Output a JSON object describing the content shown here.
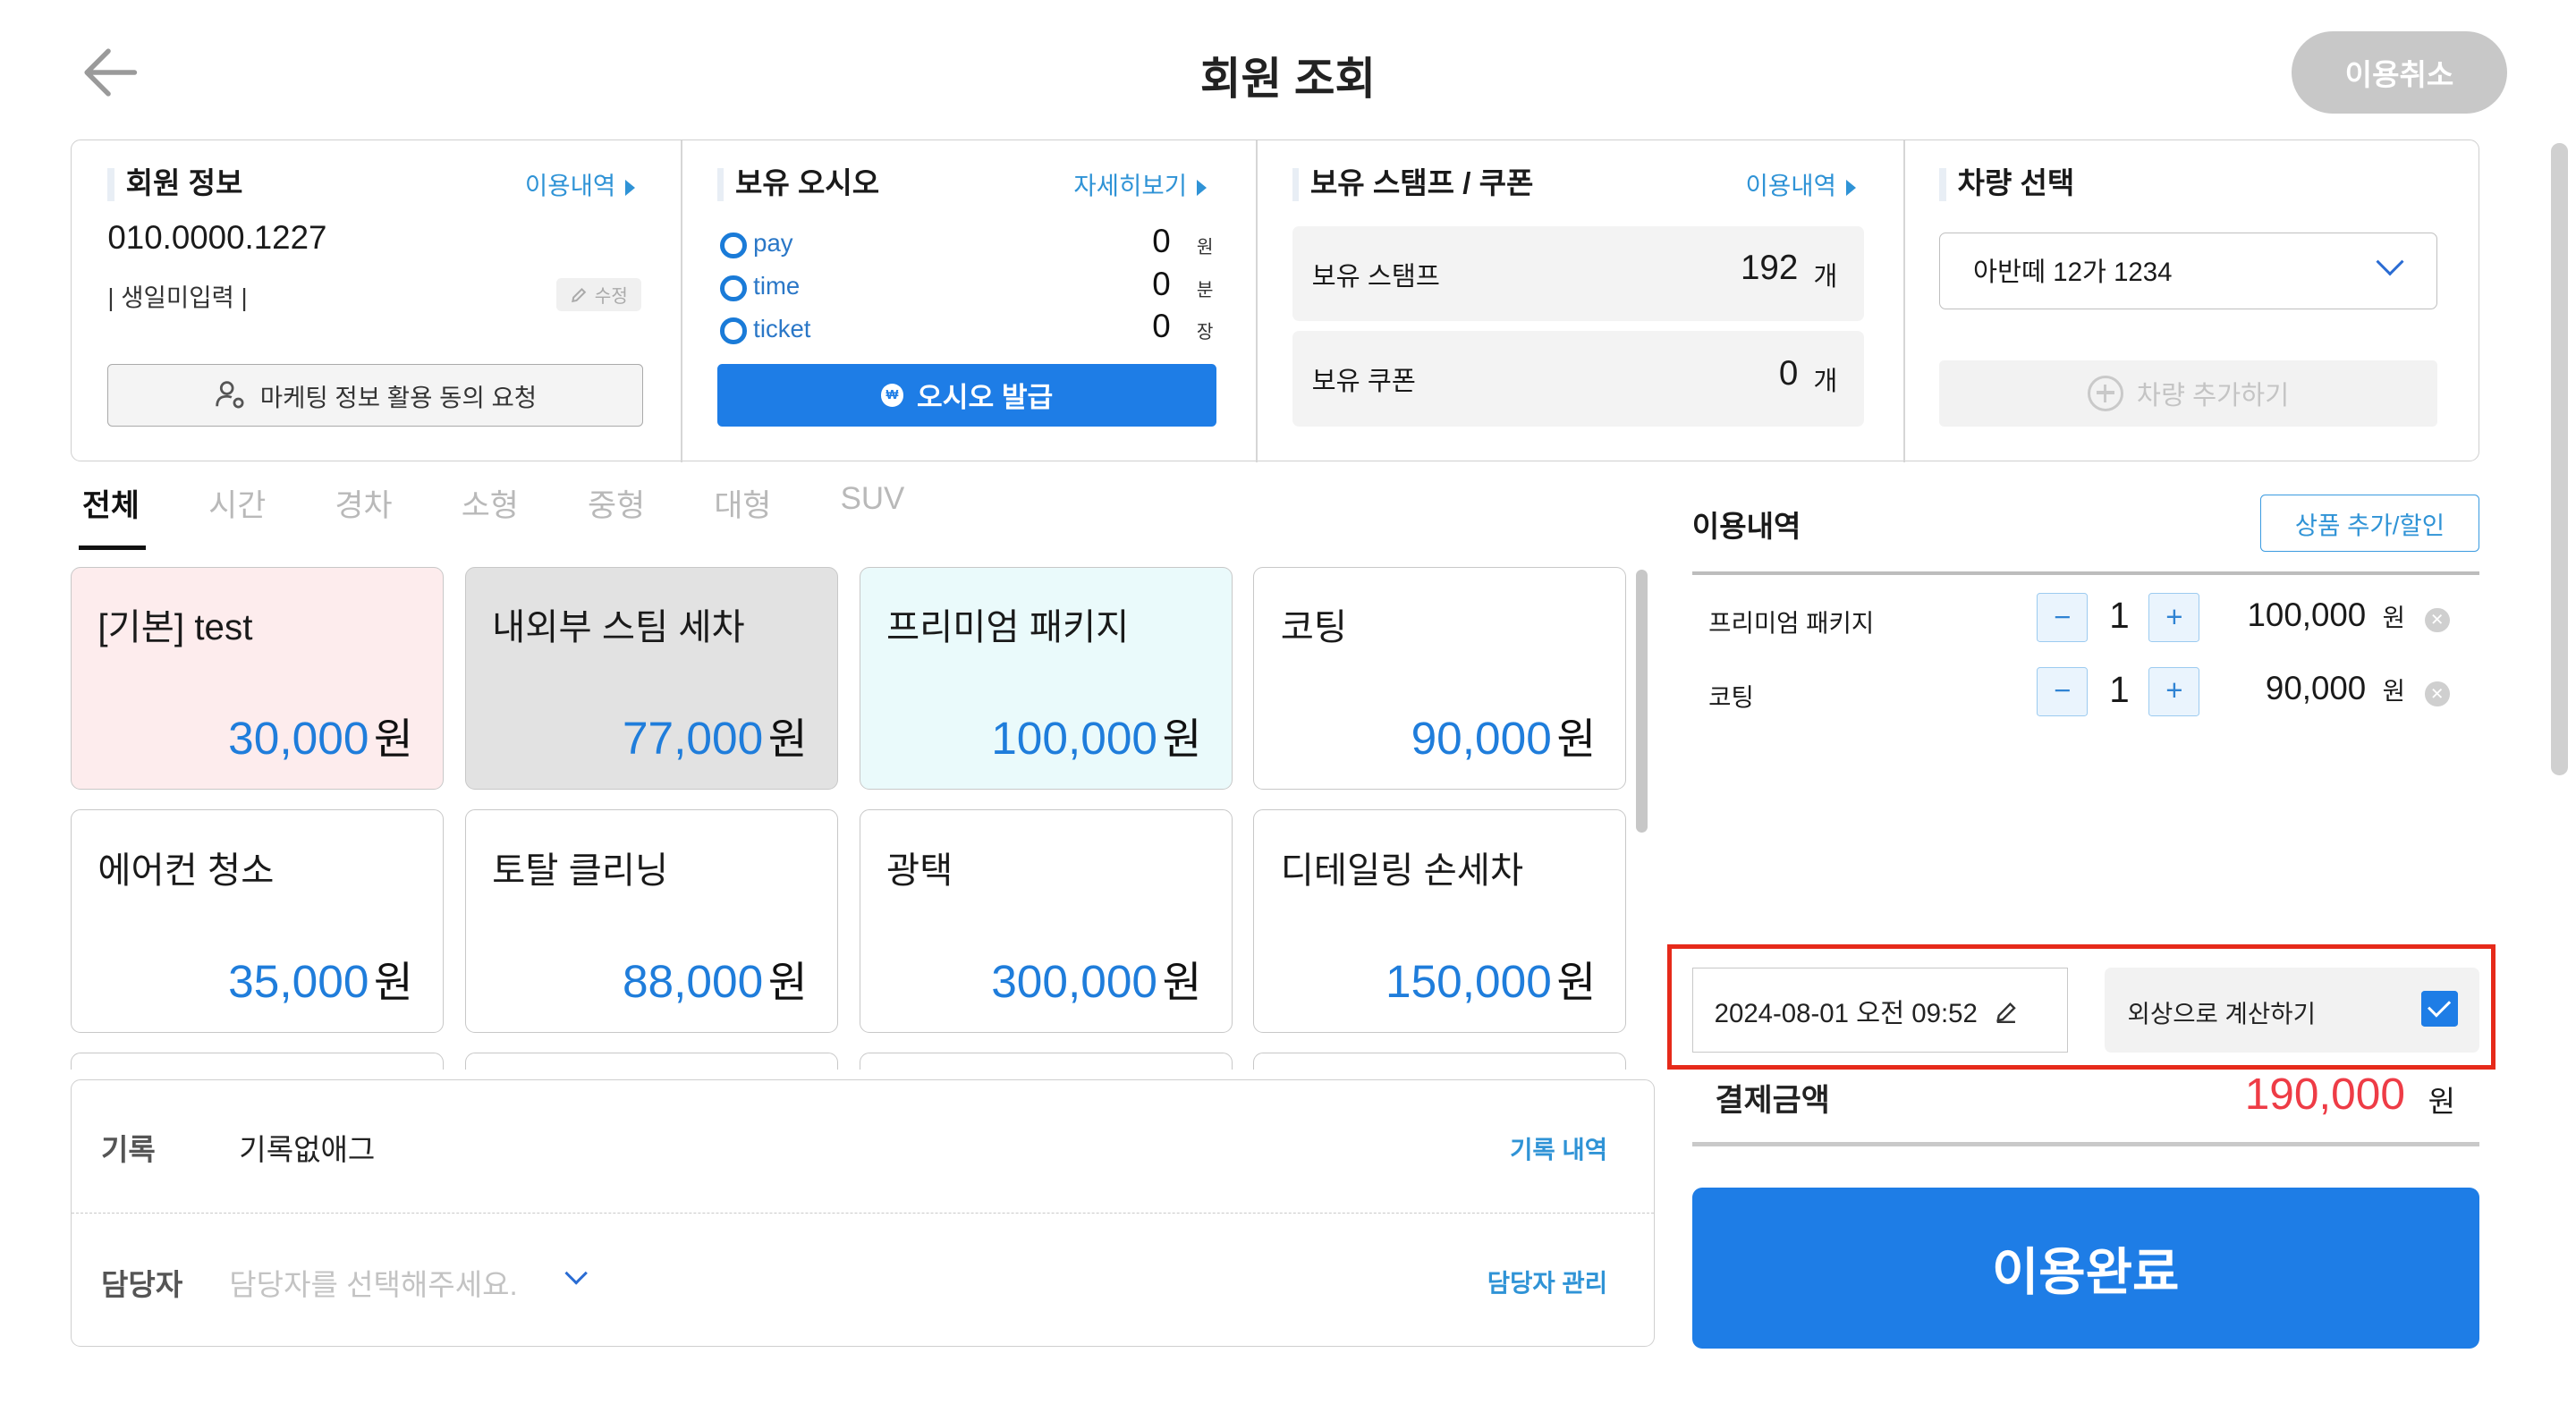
{
  "header": {
    "title": "회원 조회",
    "cancel_label": "이용취소"
  },
  "member": {
    "title": "회원 정보",
    "link": "이용내역",
    "phone": "010.0000.1227",
    "birthday": "생일미입력",
    "edit_label": "수정",
    "marketing_label": "마케팅 정보 활용 동의 요청"
  },
  "oasis": {
    "title": "보유 오시오",
    "link": "자세히보기",
    "rows": [
      {
        "label": "pay",
        "value": "0",
        "unit": "원"
      },
      {
        "label": "time",
        "value": "0",
        "unit": "분"
      },
      {
        "label": "ticket",
        "value": "0",
        "unit": "장"
      }
    ],
    "issue_label": "오시오 발급"
  },
  "stamp": {
    "title": "보유 스탬프 / 쿠폰",
    "link": "이용내역",
    "stamp_label": "보유 스탬프",
    "stamp_value": "192",
    "stamp_unit": "개",
    "coupon_label": "보유 쿠폰",
    "coupon_value": "0",
    "coupon_unit": "개"
  },
  "vehicle": {
    "title": "차량 선택",
    "selected": "아반떼 12가 1234",
    "add_label": "차량 추가하기"
  },
  "tabs": [
    "전체",
    "시간",
    "경차",
    "소형",
    "중형",
    "대형",
    "SUV"
  ],
  "won": "원",
  "products": [
    {
      "name": "[기본] test",
      "price": "30,000"
    },
    {
      "name": "내외부 스팀 세차",
      "price": "77,000"
    },
    {
      "name": "프리미엄 패키지",
      "price": "100,000"
    },
    {
      "name": "코팅",
      "price": "90,000"
    },
    {
      "name": "에어컨 청소",
      "price": "35,000"
    },
    {
      "name": "토탈 클리닝",
      "price": "88,000"
    },
    {
      "name": "광택",
      "price": "300,000"
    },
    {
      "name": "디테일링 손세차",
      "price": "150,000"
    }
  ],
  "memo": {
    "record_label": "기록",
    "record_value": "기록없애그",
    "record_link": "기록 내역",
    "staff_label": "담당자",
    "staff_placeholder": "담당자를 선택해주세요.",
    "staff_link": "담당자 관리"
  },
  "usage": {
    "title": "이용내역",
    "add_button": "상품 추가/할인",
    "items": [
      {
        "name": "프리미엄 패키지",
        "qty": "1",
        "price": "100,000",
        "unit": "원"
      },
      {
        "name": "코팅",
        "qty": "1",
        "price": "90,000",
        "unit": "원"
      }
    ]
  },
  "checkout": {
    "datetime": "2024-08-01 오전 09:52",
    "credit_label": "외상으로 계산하기",
    "credit_checked": true,
    "pay_label": "결제금액",
    "pay_value": "190,000",
    "pay_unit": "원",
    "done_label": "이용완료"
  },
  "colors": {
    "accent": "#1e7de6",
    "highlight_box": "#e62a1a",
    "pay_amount": "#ee3c46"
  }
}
